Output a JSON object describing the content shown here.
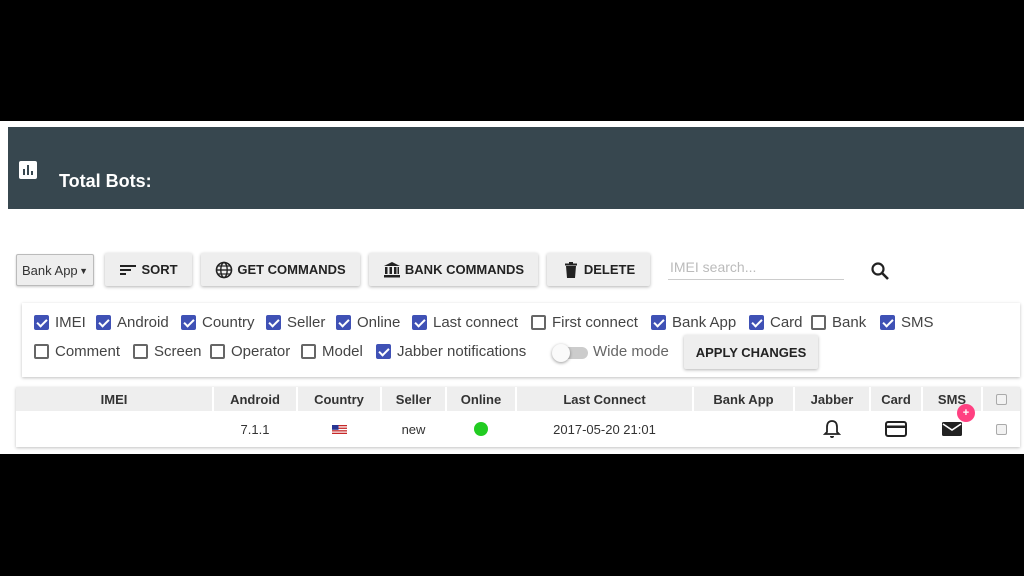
{
  "header": {
    "title": "Total Bots:"
  },
  "toolbar": {
    "bank_select": {
      "value": "Bank App"
    },
    "sort_label": "SORT",
    "get_commands_label": "GET COMMANDS",
    "bank_commands_label": "BANK COMMANDS",
    "delete_label": "DELETE",
    "search_placeholder": "IMEI search..."
  },
  "options": {
    "items": [
      {
        "label": "IMEI",
        "checked": true
      },
      {
        "label": "Android",
        "checked": true
      },
      {
        "label": "Country",
        "checked": true
      },
      {
        "label": "Seller",
        "checked": true
      },
      {
        "label": "Online",
        "checked": true
      },
      {
        "label": "Last connect",
        "checked": true
      },
      {
        "label": "First connect",
        "checked": false
      },
      {
        "label": "Bank App",
        "checked": true
      },
      {
        "label": "Card",
        "checked": true
      },
      {
        "label": "Bank",
        "checked": false
      },
      {
        "label": "SMS",
        "checked": true
      },
      {
        "label": "Comment",
        "checked": false
      },
      {
        "label": "Screen",
        "checked": false
      },
      {
        "label": "Operator",
        "checked": false
      },
      {
        "label": "Model",
        "checked": false
      },
      {
        "label": "Jabber notifications",
        "checked": true
      }
    ],
    "wide_mode": {
      "label": "Wide mode",
      "on": false
    },
    "apply_label": "APPLY CHANGES"
  },
  "table": {
    "columns": [
      "IMEI",
      "Android",
      "Country",
      "Seller",
      "Online",
      "Last Connect",
      "Bank App",
      "Jabber",
      "Card",
      "SMS"
    ],
    "rows": [
      {
        "imei": "",
        "android": "7.1.1",
        "country_flag": "us-flag-icon",
        "seller": "new",
        "online": true,
        "last_connect": "2017-05-20 21:01",
        "bank_app": "",
        "jabber_icon": "bell-icon",
        "card_icon": "credit-card-icon",
        "sms_icon": "mail-icon",
        "sms_badge": "+"
      }
    ]
  },
  "colors": {
    "header_bg": "#37474f",
    "checkbox_accent": "#3f51b5",
    "online_green": "#22cc22",
    "badge_pink": "#ff4081"
  }
}
